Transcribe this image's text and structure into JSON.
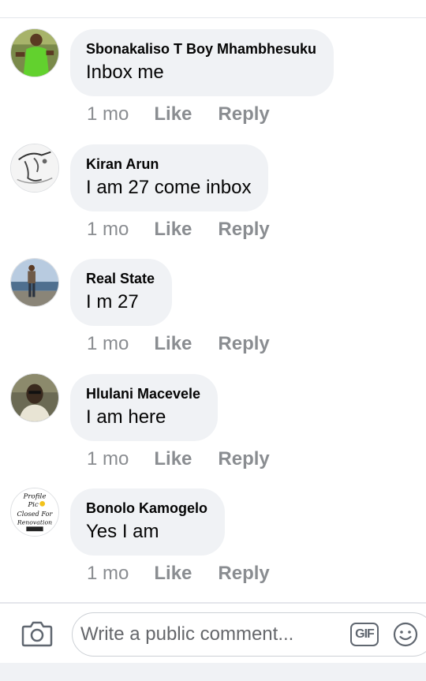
{
  "comments": [
    {
      "author": "Sbonakaliso T Boy Mhambhesuku",
      "text": "Inbox me",
      "time": "1 mo",
      "like": "Like",
      "reply": "Reply",
      "avatar_icon": "profile-photo-green-shirt"
    },
    {
      "author": "Kiran Arun",
      "text": "I am 27 come inbox",
      "time": "1 mo",
      "like": "Like",
      "reply": "Reply",
      "avatar_icon": "profile-photo-sketch"
    },
    {
      "author": "Real State",
      "text": "I m 27",
      "time": "1 mo",
      "like": "Like",
      "reply": "Reply",
      "avatar_icon": "profile-photo-beach"
    },
    {
      "author": "Hlulani Macevele",
      "text": "I am here",
      "time": "1 mo",
      "like": "Like",
      "reply": "Reply",
      "avatar_icon": "profile-photo-portrait"
    },
    {
      "author": "Bonolo Kamogelo",
      "text": "Yes I am",
      "time": "1 mo",
      "like": "Like",
      "reply": "Reply",
      "avatar_icon": "profile-pic-closed-sign"
    }
  ],
  "avatar5_sign": [
    "Profile",
    "Pic",
    "Closed For",
    "Renovation"
  ],
  "composer": {
    "placeholder": "Write a public comment...",
    "gif_label": "GIF",
    "camera_icon": "camera-icon",
    "emoji_icon": "smiley-icon"
  },
  "colors": {
    "bubble": "#f0f2f5",
    "meta_text": "#8a8d91",
    "text": "#050505"
  }
}
